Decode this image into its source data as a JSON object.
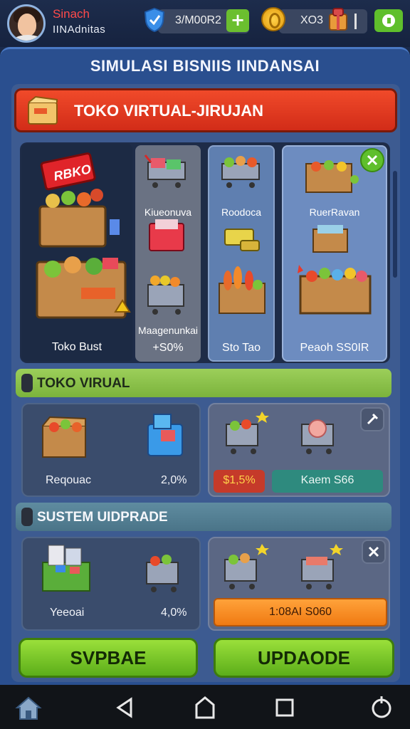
{
  "header": {
    "user_name": "Sinach",
    "user_subtitle": "IINAdnitas",
    "currency_1": "3/M00R2",
    "currency_2": "XO3",
    "plus_label": "+"
  },
  "panel": {
    "title": "SIMULASI BISNIIS IINDANSAI",
    "banner_title": "TOKO VIRTUAL-JIRUJAN"
  },
  "shop": {
    "logo_text": "RBKO",
    "left_label": "Toko Bust",
    "columns": [
      {
        "label": "Kiueonuva",
        "footer_line1": "Maagenunkai",
        "footer_line2": "+S0%"
      },
      {
        "label": "Roodoca",
        "footer": "Sto Tao"
      },
      {
        "label": "RuerRavan",
        "footer": "Peaoh SS0IR"
      }
    ]
  },
  "section_1": {
    "title": "TOKO VIRUAL",
    "left_label": "Reqouac",
    "left_value": "2,0%",
    "badge_red": "$1,5%",
    "badge_teal": "Kaem S66"
  },
  "section_2": {
    "title": "SUSTEM UIDPRADE",
    "left_label": "Yeeoai",
    "left_value": "4,0%",
    "badge_orange": "1:08AI S060"
  },
  "buttons": {
    "left": "SVPBAE",
    "right": "UPDAODE"
  },
  "colors": {
    "panel_blue": "#2a4f8f",
    "banner_red": "#e03a22",
    "bar_green": "#8ec44c",
    "button_green": "#7cc72a",
    "badge_orange": "#f78d22"
  }
}
